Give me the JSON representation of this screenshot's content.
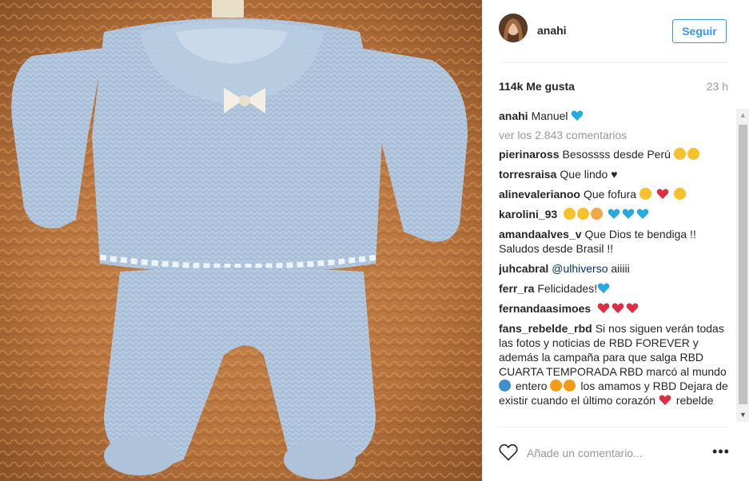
{
  "post": {
    "username": "anahi",
    "follow_label": "Seguir",
    "likes": "114k Me gusta",
    "time": "23 h",
    "view_all": "ver los 2.843 comentarios",
    "comment_placeholder": "Añade un comentario...",
    "more_label": "•••"
  },
  "caption": {
    "user": "anahi",
    "text": "Manuel"
  },
  "comments": [
    {
      "user": "pierinaross",
      "text": "Besossss desde Perú"
    },
    {
      "user": "torresraisa",
      "text": "Que lindo ♥"
    },
    {
      "user": "alinevalerianoo",
      "text": "Que fofura"
    },
    {
      "user": "karolini_93",
      "text": ""
    },
    {
      "user": "amandaalves_v",
      "text": "Que Dios te bendiga !! Saludos desde Brasil !!"
    },
    {
      "user": "juhcabral",
      "mention": "@ulhiverso",
      "text": "aiiiii"
    },
    {
      "user": "ferr_ra",
      "text": "Felicidades!"
    },
    {
      "user": "fernandaasimoes",
      "text": ""
    },
    {
      "user": "fans_rebelde_rbd",
      "text_1": "Si nos siguen verán todas las fotos y noticias de RBD FOREVER y además la campaña para que salga RBD CUARTA TEMPORADA RBD marcó al mundo",
      "text_2": "entero",
      "text_3": "los amamos y RBD Dejara de existir cuando el último corazón",
      "text_4": "rebelde"
    }
  ],
  "icons": {
    "heart_outline": "heart-icon",
    "blue_heart": "blue-heart-emoji",
    "red_heart": "red-heart-emoji"
  },
  "colors": {
    "accent": "#3897f0",
    "blue_heart": "#27a9e1",
    "red_heart": "#dd2e44",
    "muted": "#999999"
  }
}
